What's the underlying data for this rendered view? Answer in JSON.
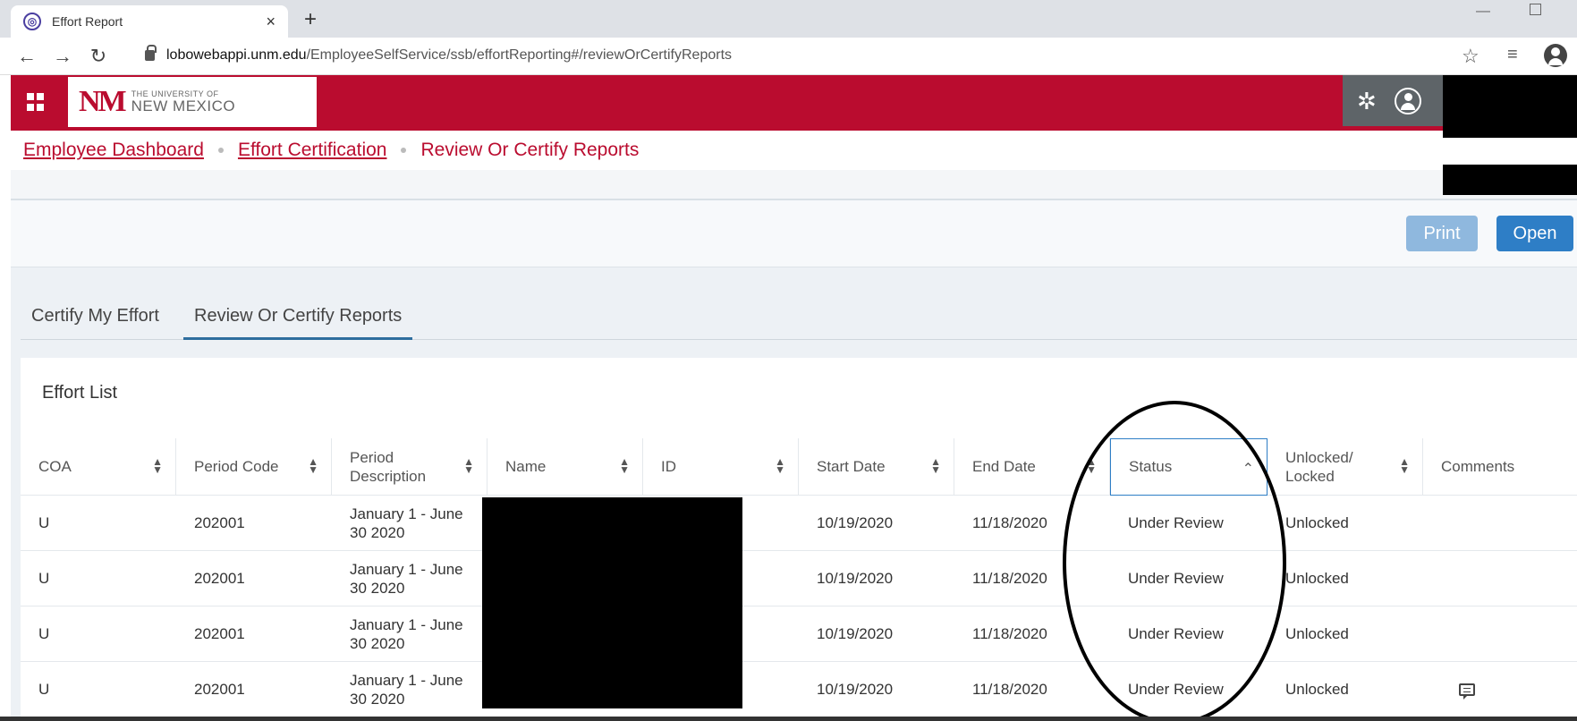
{
  "browser": {
    "tab_title": "Effort Report",
    "tab_close": "×",
    "new_tab": "+",
    "url_host": "lobowebappi.unm.edu",
    "url_path": "/EmployeeSelfService/ssb/effortReporting#/reviewOrCertifyReports",
    "icons": [
      "back-arrow-icon",
      "forward-arrow-icon",
      "reload-icon",
      "lock-icon",
      "star-icon",
      "reading-list-icon",
      "profile-icon"
    ]
  },
  "header": {
    "logo_mark": "NM",
    "logo_small": "THE UNIVERSITY OF",
    "logo_big": "NEW MEXICO",
    "brand_color": "#ba0c2f"
  },
  "breadcrumb": {
    "items": [
      "Employee Dashboard",
      "Effort Certification"
    ],
    "current": "Review Or Certify Reports"
  },
  "toolbar": {
    "print_label": "Print",
    "open_label": "Open"
  },
  "tabs": {
    "items": [
      "Certify My Effort",
      "Review Or Certify Reports"
    ],
    "active": "Review Or Certify Reports"
  },
  "effort_list": {
    "title": "Effort List",
    "columns": [
      "COA",
      "Period Code",
      "Period Description",
      "Name",
      "ID",
      "Start Date",
      "End Date",
      "Status",
      "Unlocked/ Locked",
      "Comments"
    ],
    "rows": [
      {
        "coa": "U",
        "period_code": "202001",
        "period_description": "January 1 - June 30 2020",
        "start_date": "10/19/2020",
        "end_date": "11/18/2020",
        "status": "Under Review",
        "locked": "Unlocked",
        "has_comment": false
      },
      {
        "coa": "U",
        "period_code": "202001",
        "period_description": "January 1 - June 30 2020",
        "start_date": "10/19/2020",
        "end_date": "11/18/2020",
        "status": "Under Review",
        "locked": "Unlocked",
        "has_comment": false
      },
      {
        "coa": "U",
        "period_code": "202001",
        "period_description": "January 1 - June 30 2020",
        "start_date": "10/19/2020",
        "end_date": "11/18/2020",
        "status": "Under Review",
        "locked": "Unlocked",
        "has_comment": false
      },
      {
        "coa": "U",
        "period_code": "202001",
        "period_description": "January 1 - June 30 2020",
        "start_date": "10/19/2020",
        "end_date": "11/18/2020",
        "status": "Under Review",
        "locked": "Unlocked",
        "has_comment": true
      }
    ]
  }
}
